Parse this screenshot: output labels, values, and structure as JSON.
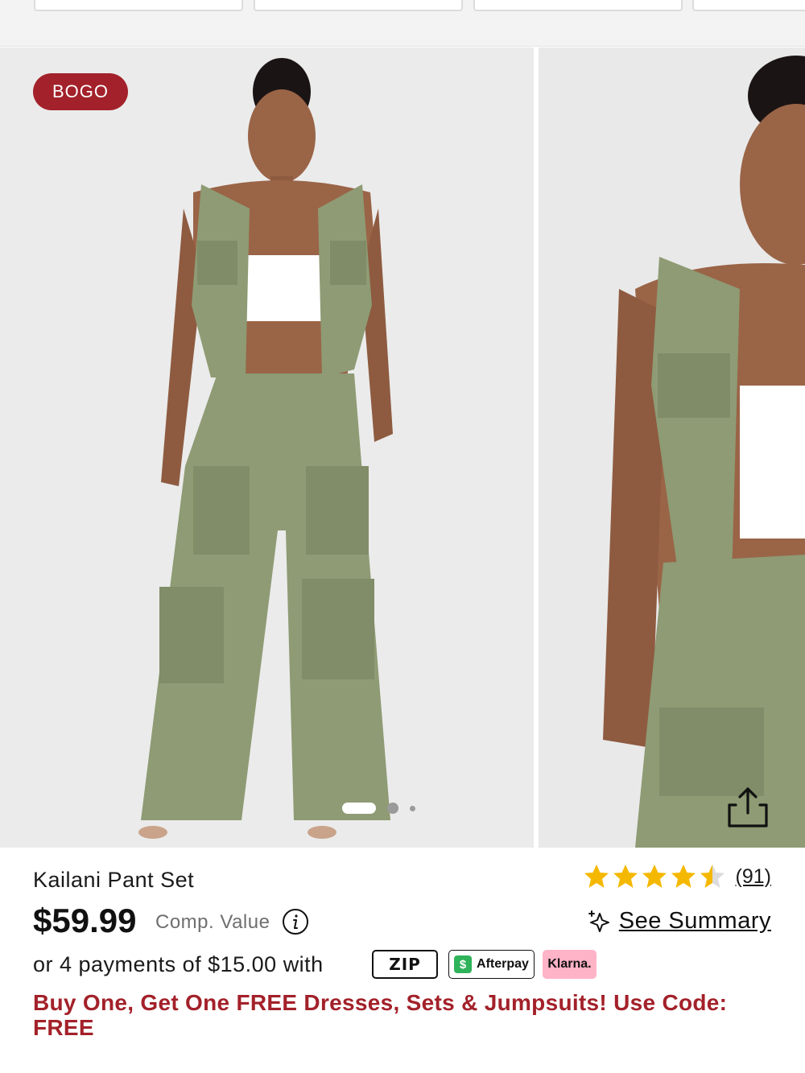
{
  "badge": {
    "label": "BOGO"
  },
  "product": {
    "title": "Kailani Pant Set",
    "price": "$59.99",
    "comp_value_label": "Comp. Value",
    "rating": 4.5,
    "review_count": "(91)",
    "summary_label": "See Summary"
  },
  "payments": {
    "text": "or 4 payments of $15.00 with",
    "providers": {
      "zip": "ZIP",
      "afterpay": "Afterpay",
      "afterpay_mark": "$",
      "klarna": "Klarna."
    }
  },
  "promo": {
    "text": "Buy One, Get One FREE Dresses, Sets & Jumpsuits! Use Code: FREE"
  },
  "carousel": {
    "total_slides": 3,
    "active_index": 0
  },
  "colors": {
    "accent": "#a3212a",
    "star": "#f5b800",
    "star_empty": "#dcdcdc",
    "outfit": "#8e9b74"
  },
  "icons": {
    "share": "share-icon",
    "info": "info-icon",
    "sparkle": "sparkle-icon",
    "star": "star-icon"
  }
}
